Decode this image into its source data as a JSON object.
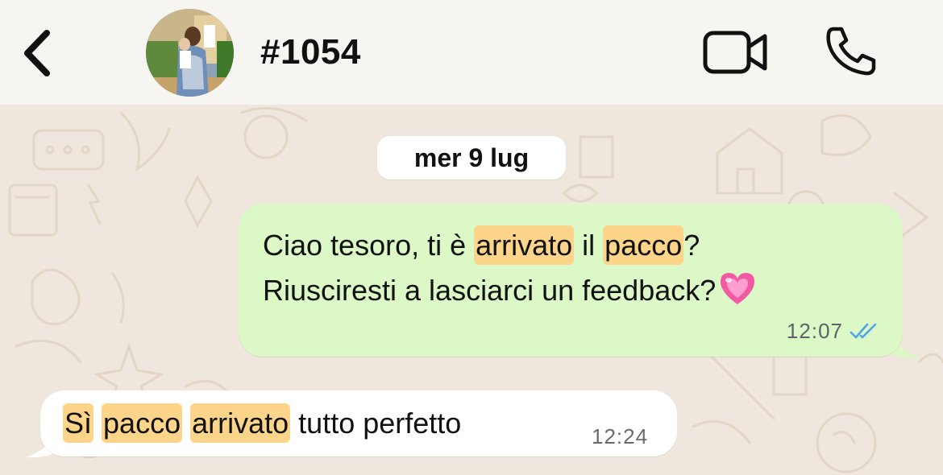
{
  "header": {
    "contact_name": "#1054",
    "back_icon": "chevron-left-icon",
    "video_icon": "video-camera-icon",
    "call_icon": "phone-icon"
  },
  "chat": {
    "date_label": "mer 9 lug",
    "messages": [
      {
        "direction": "outgoing",
        "line1": [
          "Ciao tesoro, ti è ",
          "arrivato",
          " il ",
          "pacco",
          "?"
        ],
        "line2": "Riusciresti a lasciarci un feedback?",
        "emoji": "pink-heart",
        "time": "12:07",
        "status": "read"
      },
      {
        "direction": "incoming",
        "parts": [
          "Sì",
          " ",
          "pacco",
          " ",
          "arrivato",
          " tutto perfetto"
        ],
        "time": "12:24"
      }
    ]
  },
  "colors": {
    "outgoing_bubble": "#dcf8c6",
    "incoming_bubble": "#ffffff",
    "highlight": "#fcd58a",
    "read_ticks": "#4fa3e8",
    "chat_background": "#efe7dd"
  }
}
